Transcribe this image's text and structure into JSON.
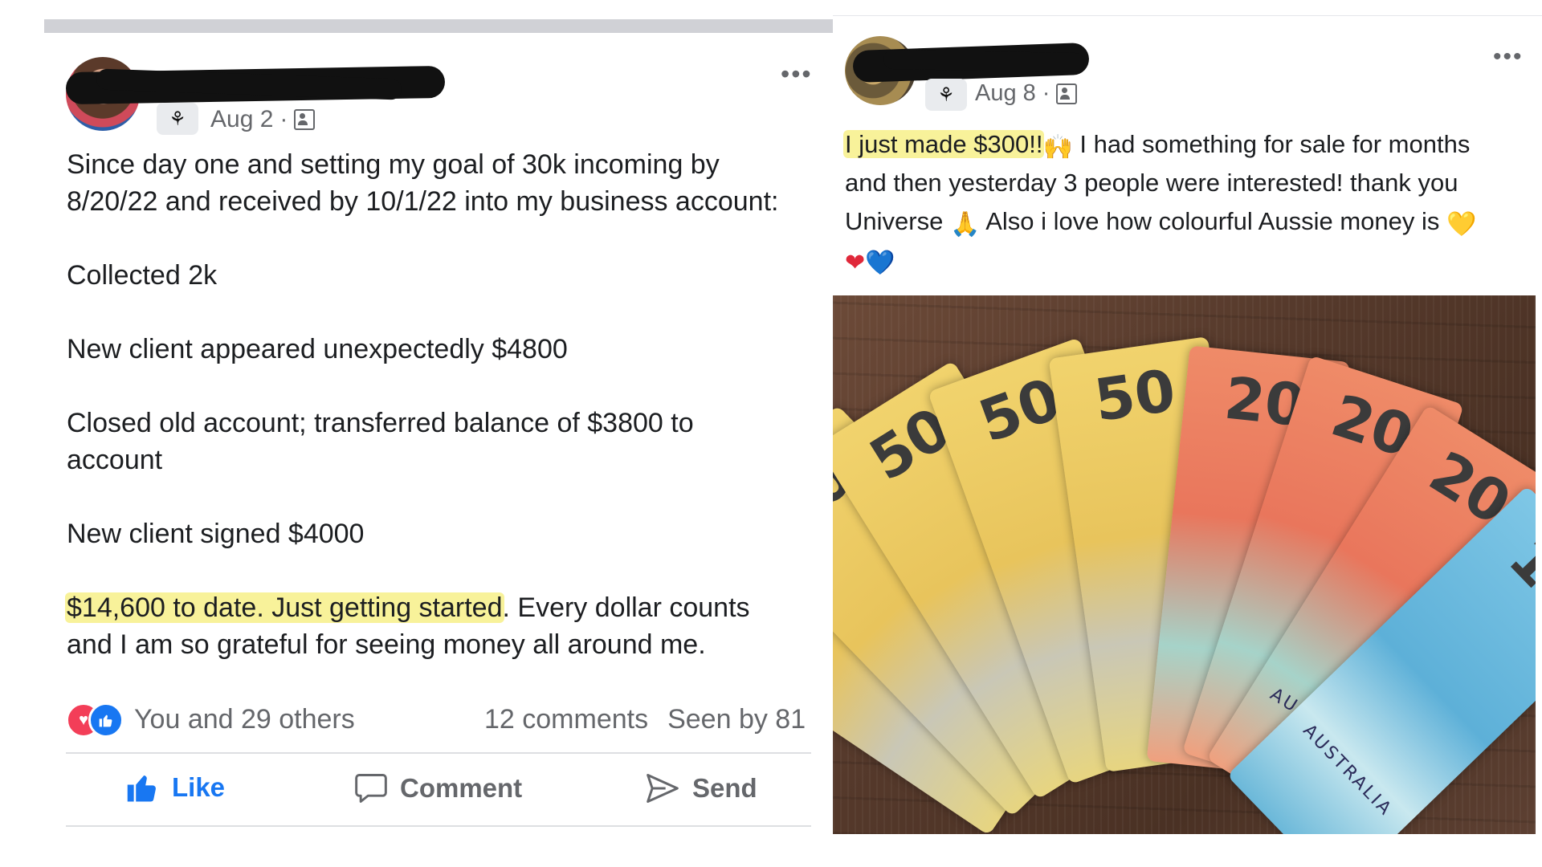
{
  "left_post": {
    "date": "Aug 2",
    "separator": "·",
    "more": "•••",
    "lines": [
      "Since day one and setting my goal of 30k incoming by",
      "8/20/22 and received by 10/1/22 into my business account:",
      "Collected 2k",
      "New client appeared unexpectedly $4800",
      "Closed old account; transferred balance of $3800 to",
      "account",
      "New client signed $4000"
    ],
    "highlight": "$14,600 to date. Just getting started",
    "after_highlight": ". Every dollar counts",
    "last_line": "and I am so grateful for seeing money all around me.",
    "reactions": "You and 29 others",
    "comments": "12 comments",
    "seen": "Seen by 81",
    "actions": {
      "like": "Like",
      "comment": "Comment",
      "send": "Send"
    }
  },
  "right_post": {
    "date": "Aug 8",
    "separator": "·",
    "more": "•••",
    "highlight": "I just made $300!!",
    "emoji_raise": "🙌",
    "text1": " I had something for sale for months",
    "text2": "and then yesterday 3 people were interested! thank you",
    "text3a": "Universe ",
    "emoji_pray": "🙏",
    "text3b": " Also i love how colourful Aussie money is ",
    "emoji_heart_yellow": "💛",
    "emoji_heart_red": "❤",
    "emoji_heart_blue": "💙",
    "photo": {
      "notes": [
        "50",
        "50",
        "50",
        "50",
        "50",
        "20",
        "20",
        "20",
        "10"
      ],
      "country": "AUSTRALIA"
    }
  },
  "colors": {
    "highlight": "#f8f29a",
    "like_blue": "#1877f2",
    "love_red": "#f33e58",
    "muted": "#65676b"
  }
}
